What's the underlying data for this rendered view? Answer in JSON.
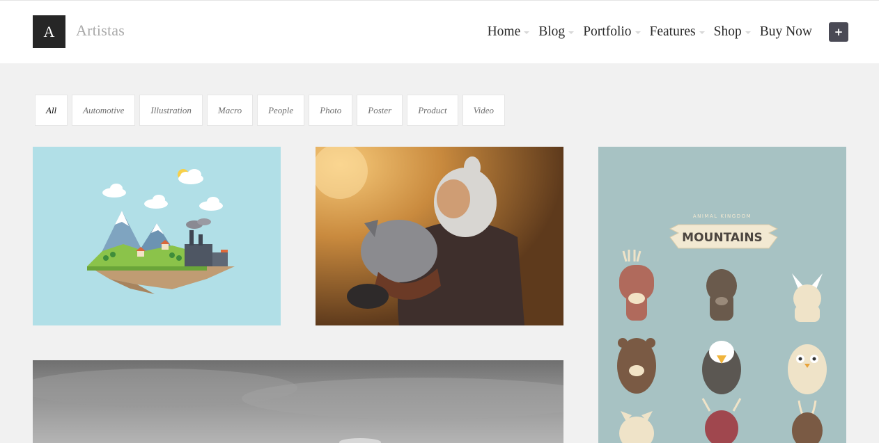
{
  "header": {
    "logo_letter": "A",
    "site_name": "Artistas",
    "nav": [
      {
        "label": "Home"
      },
      {
        "label": "Blog"
      },
      {
        "label": "Portfolio"
      },
      {
        "label": "Features"
      },
      {
        "label": "Shop"
      },
      {
        "label": "Buy Now"
      }
    ],
    "plus_label": "+"
  },
  "filters": [
    {
      "label": "All",
      "active": true
    },
    {
      "label": "Automotive"
    },
    {
      "label": "Illustration"
    },
    {
      "label": "Macro"
    },
    {
      "label": "People"
    },
    {
      "label": "Photo"
    },
    {
      "label": "Poster"
    },
    {
      "label": "Product"
    },
    {
      "label": "Video"
    }
  ],
  "portfolio": {
    "poster_subtitle": "ANIMAL KINGDOM",
    "poster_title": "MOUNTAINS"
  },
  "colors": {
    "accent_dark": "#262626",
    "plus_button": "#4a4a55",
    "tile_sky": "#b1dfe7",
    "tile_poster": "#a7c2c3"
  }
}
